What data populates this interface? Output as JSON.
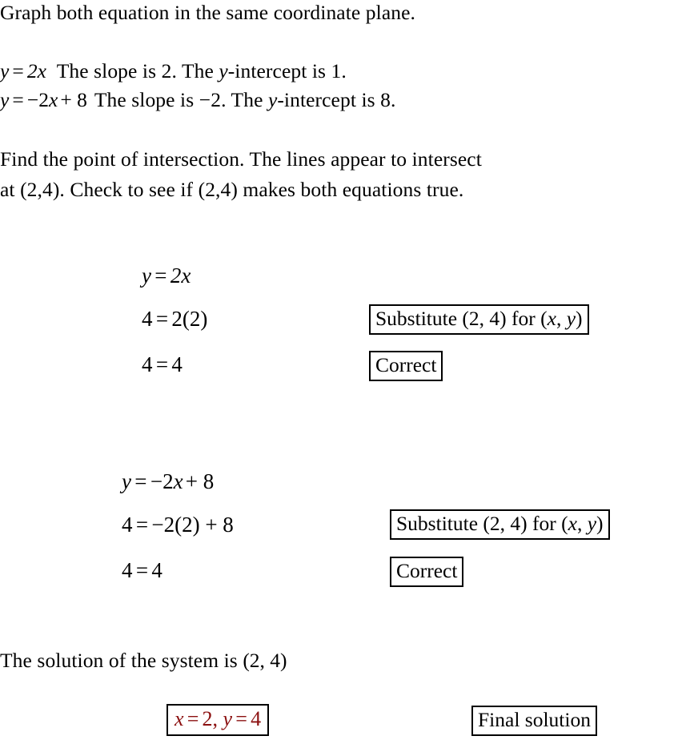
{
  "document": {
    "title": "Graph both equation in the same coordinate plane.",
    "background_color": "#ffffff",
    "text_color": "#000000",
    "accent_color": "#8b1010"
  },
  "intro": {
    "heading": "Graph both equation in the same coordinate plane.",
    "equation_1_lhs": "y",
    "equation_1_rhs": "2x",
    "equation_1_desc": "The slope is 2.  The ",
    "equation_1_desc_var": "y",
    "equation_1_desc_tail": "-intercept is 1.",
    "equation_2_lhs": "y",
    "equation_2_rhs_neg": "−2",
    "equation_2_rhs_var": "x",
    "equation_2_rhs_plus": "+ 8",
    "equation_2_desc": "The slope is −2.  The ",
    "equation_2_desc_var": "y",
    "equation_2_desc_tail": "-intercept is 8."
  },
  "instructions": {
    "line_1": "Find the point of intersection.  The lines appear to intersect",
    "line_2": "at (2,4).  Check to see if (2,4) makes both equations true."
  },
  "check_block_1": {
    "step_1": "y = 2x",
    "step_1_lhs": "y",
    "step_1_rhs": "2x",
    "step_2": "4 = 2(2)",
    "step_2_lhs": "4",
    "step_2_rhs": "2(2)",
    "step_3": "4 = 4",
    "step_3_lhs": "4",
    "step_3_rhs": "4",
    "note_substitute": "Substitute (2, 4) for (x, y)",
    "note_substitute_prefix": "Substitute (2, 4) for (",
    "note_substitute_var_x": "x",
    "note_substitute_comma": ", ",
    "note_substitute_var_y": "y",
    "note_substitute_suffix": ")",
    "note_correct": "Correct"
  },
  "check_block_2": {
    "step_1": "y = −2x + 8",
    "step_1_lhs": "y",
    "step_1_rhs_neg": "−2",
    "step_1_rhs_var": "x",
    "step_1_rhs_plus": "+ 8",
    "step_2": "4 = −2(2) + 8",
    "step_2_lhs": "4",
    "step_2_rhs": "−2(2) + 8",
    "step_3": "4 = 4",
    "step_3_lhs": "4",
    "step_3_rhs": "4",
    "note_substitute_prefix": "Substitute (2, 4) for (",
    "note_substitute_var_x": "x",
    "note_substitute_comma": ", ",
    "note_substitute_var_y": "y",
    "note_substitute_suffix": ")",
    "note_correct": "Correct"
  },
  "conclusion": {
    "statement_prefix": "The solution of the system is ",
    "statement_point": "(2, 4)",
    "answer_x_var": "x",
    "answer_x_val": "2",
    "answer_sep": ",",
    "answer_y_var": "y",
    "answer_y_val": "4",
    "note_final": "Final solution"
  }
}
